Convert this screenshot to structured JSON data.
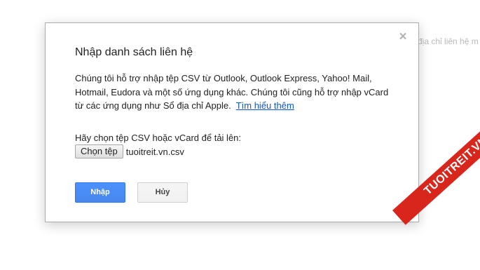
{
  "background": {
    "partial_text": "địa chỉ liên hệ m"
  },
  "dialog": {
    "title": "Nhập danh sách liên hệ",
    "description": "Chúng tôi hỗ trợ nhập tệp CSV từ Outlook, Outlook Express, Yahoo! Mail, Hotmail, Eudora và một số ứng dụng khác. Chúng tôi cũng hỗ trợ nhập vCard từ các ứng dụng như Sổ địa chỉ Apple.",
    "learn_more_link": "Tìm hiểu thêm",
    "choose_label": "Hãy chọn tệp CSV hoặc vCard để tải lên:",
    "choose_file_button": "Chọn tệp",
    "selected_file": "tuoitreit.vn.csv",
    "import_button": "Nhập",
    "cancel_button": "Hủy",
    "close_icon": "close-icon"
  },
  "watermark": {
    "text": "TUOITREIT.VN"
  },
  "colors": {
    "primary_button": "#4d90fe",
    "link": "#1155cc",
    "watermark": "#d9261c"
  }
}
